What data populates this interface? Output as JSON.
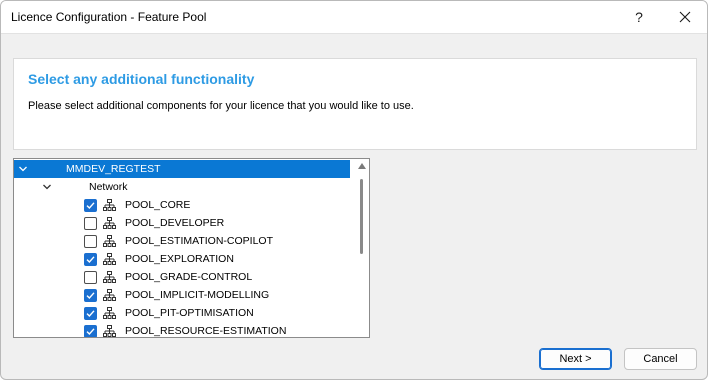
{
  "window": {
    "title": "Licence Configuration - Feature Pool",
    "help_label": "?",
    "close_label": "✕"
  },
  "header": {
    "title": "Select any additional functionality",
    "subtitle": "Please select additional components for your licence that you would like to use."
  },
  "tree": {
    "root": {
      "label": "MMDEV_REGTEST",
      "expanded": true,
      "selected": true
    },
    "group": {
      "label": "Network",
      "expanded": true
    },
    "items": [
      {
        "label": "POOL_CORE",
        "checked": true
      },
      {
        "label": "POOL_DEVELOPER",
        "checked": false
      },
      {
        "label": "POOL_ESTIMATION-COPILOT",
        "checked": false
      },
      {
        "label": "POOL_EXPLORATION",
        "checked": true
      },
      {
        "label": "POOL_GRADE-CONTROL",
        "checked": false
      },
      {
        "label": "POOL_IMPLICIT-MODELLING",
        "checked": true
      },
      {
        "label": "POOL_PIT-OPTIMISATION",
        "checked": true
      },
      {
        "label": "POOL_RESOURCE-ESTIMATION",
        "checked": true
      }
    ]
  },
  "buttons": {
    "next_label": "Next >",
    "cancel_label": "Cancel"
  },
  "colors": {
    "accent": "#0a78d4",
    "header_title": "#2e9be4",
    "checkbox_checked": "#1a6fd0"
  }
}
